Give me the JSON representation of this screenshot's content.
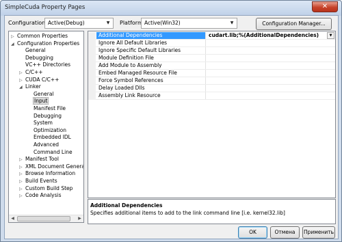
{
  "window": {
    "title": "SimpleCuda Property Pages",
    "close_glyph": "✕"
  },
  "toolbar": {
    "configuration_label": "Configuration:",
    "configuration_value": "Active(Debug)",
    "platform_label": "Platform:",
    "platform_value": "Active(Win32)",
    "config_manager_label": "Configuration Manager..."
  },
  "tree": {
    "items": [
      {
        "label": "Common Properties",
        "toggle": "▷"
      },
      {
        "label": "Configuration Properties",
        "toggle": "◢"
      },
      {
        "label": "General",
        "toggle": ""
      },
      {
        "label": "Debugging",
        "toggle": ""
      },
      {
        "label": "VC++ Directories",
        "toggle": ""
      },
      {
        "label": "C/C++",
        "toggle": "▷"
      },
      {
        "label": "CUDA C/C++",
        "toggle": "▷"
      },
      {
        "label": "Linker",
        "toggle": "◢"
      },
      {
        "label": "General",
        "toggle": ""
      },
      {
        "label": "Input",
        "toggle": ""
      },
      {
        "label": "Manifest File",
        "toggle": ""
      },
      {
        "label": "Debugging",
        "toggle": ""
      },
      {
        "label": "System",
        "toggle": ""
      },
      {
        "label": "Optimization",
        "toggle": ""
      },
      {
        "label": "Embedded IDL",
        "toggle": ""
      },
      {
        "label": "Advanced",
        "toggle": ""
      },
      {
        "label": "Command Line",
        "toggle": ""
      },
      {
        "label": "Manifest Tool",
        "toggle": "▷"
      },
      {
        "label": "XML Document Generator",
        "toggle": "▷"
      },
      {
        "label": "Browse Information",
        "toggle": "▷"
      },
      {
        "label": "Build Events",
        "toggle": "▷"
      },
      {
        "label": "Custom Build Step",
        "toggle": "▷"
      },
      {
        "label": "Code Analysis",
        "toggle": "▷"
      }
    ],
    "selected": "Input"
  },
  "grid": {
    "rows": [
      {
        "name": "Additional Dependencies",
        "value": "cudart.lib;%(AdditionalDependencies)"
      },
      {
        "name": "Ignore All Default Libraries",
        "value": ""
      },
      {
        "name": "Ignore Specific Default Libraries",
        "value": ""
      },
      {
        "name": "Module Definition File",
        "value": ""
      },
      {
        "name": "Add Module to Assembly",
        "value": ""
      },
      {
        "name": "Embed Managed Resource File",
        "value": ""
      },
      {
        "name": "Force Symbol References",
        "value": ""
      },
      {
        "name": "Delay Loaded Dlls",
        "value": ""
      },
      {
        "name": "Assembly Link Resource",
        "value": ""
      }
    ]
  },
  "description": {
    "title": "Additional Dependencies",
    "text": "Specifies additional items to add to the link command line [i.e. kernel32.lib]"
  },
  "buttons": {
    "ok": "OK",
    "cancel": "Отмена",
    "apply": "Применить"
  },
  "colors": {
    "selection": "#3399ff",
    "frame": "#cfdcec"
  }
}
